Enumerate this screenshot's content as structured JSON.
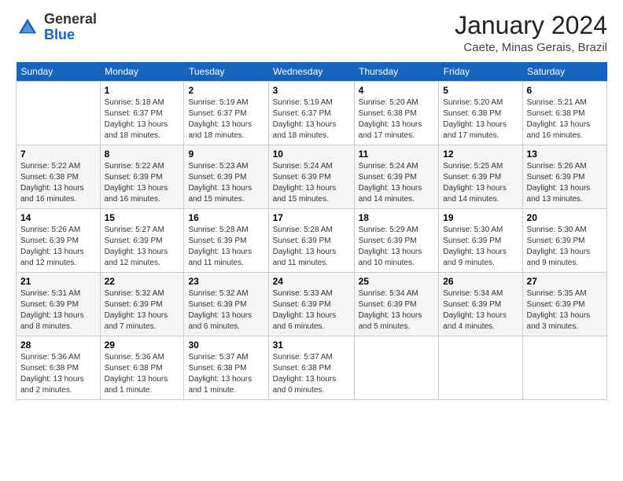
{
  "header": {
    "logo_line1": "General",
    "logo_line2": "Blue",
    "month_title": "January 2024",
    "location": "Caete, Minas Gerais, Brazil"
  },
  "days_of_week": [
    "Sunday",
    "Monday",
    "Tuesday",
    "Wednesday",
    "Thursday",
    "Friday",
    "Saturday"
  ],
  "weeks": [
    [
      {
        "day": "",
        "info": ""
      },
      {
        "day": "1",
        "info": "Sunrise: 5:18 AM\nSunset: 6:37 PM\nDaylight: 13 hours\nand 18 minutes."
      },
      {
        "day": "2",
        "info": "Sunrise: 5:19 AM\nSunset: 6:37 PM\nDaylight: 13 hours\nand 18 minutes."
      },
      {
        "day": "3",
        "info": "Sunrise: 5:19 AM\nSunset: 6:37 PM\nDaylight: 13 hours\nand 18 minutes."
      },
      {
        "day": "4",
        "info": "Sunrise: 5:20 AM\nSunset: 6:38 PM\nDaylight: 13 hours\nand 17 minutes."
      },
      {
        "day": "5",
        "info": "Sunrise: 5:20 AM\nSunset: 6:38 PM\nDaylight: 13 hours\nand 17 minutes."
      },
      {
        "day": "6",
        "info": "Sunrise: 5:21 AM\nSunset: 6:38 PM\nDaylight: 13 hours\nand 16 minutes."
      }
    ],
    [
      {
        "day": "7",
        "info": "Sunrise: 5:22 AM\nSunset: 6:38 PM\nDaylight: 13 hours\nand 16 minutes."
      },
      {
        "day": "8",
        "info": "Sunrise: 5:22 AM\nSunset: 6:39 PM\nDaylight: 13 hours\nand 16 minutes."
      },
      {
        "day": "9",
        "info": "Sunrise: 5:23 AM\nSunset: 6:39 PM\nDaylight: 13 hours\nand 15 minutes."
      },
      {
        "day": "10",
        "info": "Sunrise: 5:24 AM\nSunset: 6:39 PM\nDaylight: 13 hours\nand 15 minutes."
      },
      {
        "day": "11",
        "info": "Sunrise: 5:24 AM\nSunset: 6:39 PM\nDaylight: 13 hours\nand 14 minutes."
      },
      {
        "day": "12",
        "info": "Sunrise: 5:25 AM\nSunset: 6:39 PM\nDaylight: 13 hours\nand 14 minutes."
      },
      {
        "day": "13",
        "info": "Sunrise: 5:26 AM\nSunset: 6:39 PM\nDaylight: 13 hours\nand 13 minutes."
      }
    ],
    [
      {
        "day": "14",
        "info": "Sunrise: 5:26 AM\nSunset: 6:39 PM\nDaylight: 13 hours\nand 12 minutes."
      },
      {
        "day": "15",
        "info": "Sunrise: 5:27 AM\nSunset: 6:39 PM\nDaylight: 13 hours\nand 12 minutes."
      },
      {
        "day": "16",
        "info": "Sunrise: 5:28 AM\nSunset: 6:39 PM\nDaylight: 13 hours\nand 11 minutes."
      },
      {
        "day": "17",
        "info": "Sunrise: 5:28 AM\nSunset: 6:39 PM\nDaylight: 13 hours\nand 11 minutes."
      },
      {
        "day": "18",
        "info": "Sunrise: 5:29 AM\nSunset: 6:39 PM\nDaylight: 13 hours\nand 10 minutes."
      },
      {
        "day": "19",
        "info": "Sunrise: 5:30 AM\nSunset: 6:39 PM\nDaylight: 13 hours\nand 9 minutes."
      },
      {
        "day": "20",
        "info": "Sunrise: 5:30 AM\nSunset: 6:39 PM\nDaylight: 13 hours\nand 9 minutes."
      }
    ],
    [
      {
        "day": "21",
        "info": "Sunrise: 5:31 AM\nSunset: 6:39 PM\nDaylight: 13 hours\nand 8 minutes."
      },
      {
        "day": "22",
        "info": "Sunrise: 5:32 AM\nSunset: 6:39 PM\nDaylight: 13 hours\nand 7 minutes."
      },
      {
        "day": "23",
        "info": "Sunrise: 5:32 AM\nSunset: 6:39 PM\nDaylight: 13 hours\nand 6 minutes."
      },
      {
        "day": "24",
        "info": "Sunrise: 5:33 AM\nSunset: 6:39 PM\nDaylight: 13 hours\nand 6 minutes."
      },
      {
        "day": "25",
        "info": "Sunrise: 5:34 AM\nSunset: 6:39 PM\nDaylight: 13 hours\nand 5 minutes."
      },
      {
        "day": "26",
        "info": "Sunrise: 5:34 AM\nSunset: 6:39 PM\nDaylight: 13 hours\nand 4 minutes."
      },
      {
        "day": "27",
        "info": "Sunrise: 5:35 AM\nSunset: 6:39 PM\nDaylight: 13 hours\nand 3 minutes."
      }
    ],
    [
      {
        "day": "28",
        "info": "Sunrise: 5:36 AM\nSunset: 6:38 PM\nDaylight: 13 hours\nand 2 minutes."
      },
      {
        "day": "29",
        "info": "Sunrise: 5:36 AM\nSunset: 6:38 PM\nDaylight: 13 hours\nand 1 minute."
      },
      {
        "day": "30",
        "info": "Sunrise: 5:37 AM\nSunset: 6:38 PM\nDaylight: 13 hours\nand 1 minute."
      },
      {
        "day": "31",
        "info": "Sunrise: 5:37 AM\nSunset: 6:38 PM\nDaylight: 13 hours\nand 0 minutes."
      },
      {
        "day": "",
        "info": ""
      },
      {
        "day": "",
        "info": ""
      },
      {
        "day": "",
        "info": ""
      }
    ]
  ]
}
